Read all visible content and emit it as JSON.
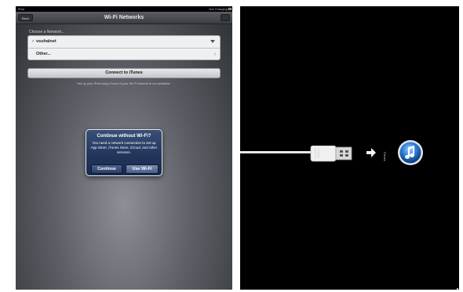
{
  "left": {
    "status": {
      "device": "iPad",
      "charging": "Not Charging"
    },
    "nav": {
      "title": "Wi-Fi Networks",
      "back": "Back"
    },
    "choose_label": "Choose a Network...",
    "networks": [
      {
        "name": "vsuhalnet",
        "selected": true
      },
      {
        "name": "Other...",
        "selected": false
      }
    ],
    "connect_button": "Connect to iTunes",
    "connect_hint": "Set up your iPad using iTunes if your Wi-Fi network is not available.",
    "alert": {
      "title": "Continue without Wi-Fi?",
      "message": "You need a network connection to set up App Store, iTunes Store, iCloud, and other services.",
      "buttons": {
        "continue": "Continue",
        "use_wifi": "Use Wi-Fi"
      }
    },
    "icons": {
      "check": "checkmark-icon",
      "wifi": "wifi-icon",
      "chevron": "chevron-right-icon"
    }
  },
  "right": {
    "label": "iTunes",
    "icons": {
      "cable": "usb-cable-icon",
      "arrow": "arrow-right-icon",
      "itunes": "itunes-icon"
    }
  },
  "colors": {
    "alert_blue": "#23365c",
    "panel_dark": "#000000"
  }
}
